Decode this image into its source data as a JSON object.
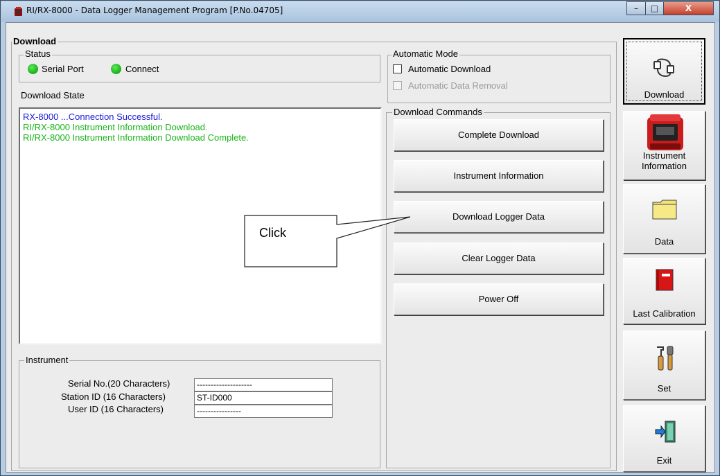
{
  "window": {
    "title": "RI/RX-8000  - Data Logger Management Program [P.No.04705]",
    "controls": {
      "minimize": "–",
      "maximize": "□",
      "close": "X"
    }
  },
  "download_group": {
    "label": "Download",
    "status": {
      "label": "Status",
      "indicators": [
        {
          "label": "Serial Port",
          "color": "#19b519"
        },
        {
          "label": "Connect",
          "color": "#19b519"
        }
      ]
    },
    "state_label": "Download State",
    "log_lines": [
      {
        "text": "RX-8000 ...Connection Successful.",
        "color": "#1b1bd8"
      },
      {
        "text": "RI/RX-8000 Instrument Information Download.",
        "color": "#18b418"
      },
      {
        "text": "RI/RX-8000 Instrument Information Download Complete.",
        "color": "#18b418"
      }
    ]
  },
  "automatic_mode": {
    "label": "Automatic Mode",
    "automatic_download": {
      "label": "Automatic Download",
      "checked": false
    },
    "automatic_data_removal": {
      "label": "Automatic Data Removal",
      "checked": false
    }
  },
  "download_commands": {
    "label": "Download Commands",
    "buttons": [
      "Complete Download",
      "Instrument Information",
      "Download Logger Data",
      "Clear Logger Data",
      "Power Off"
    ]
  },
  "callout": {
    "text": "Click"
  },
  "instrument": {
    "label": "Instrument",
    "serial": {
      "label": "Serial No.(20 Characters)",
      "value": "--------------------"
    },
    "station": {
      "label": "Station ID (16 Characters)",
      "value": "ST-ID000"
    },
    "user": {
      "label": "User ID (16 Characters)",
      "value": "----------------"
    }
  },
  "sidebar": {
    "download": "Download",
    "instrument_info_line1": "Instrument",
    "instrument_info_line2": "Information",
    "data": "Data",
    "last_calibration": "Last Calibration",
    "set": "Set",
    "exit": "Exit"
  }
}
